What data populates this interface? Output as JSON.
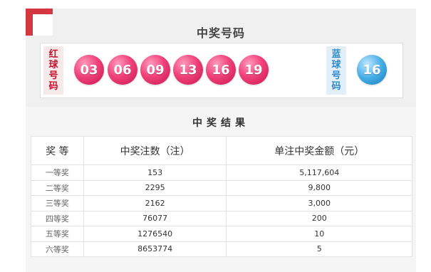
{
  "draw": {
    "title": "中奖号码",
    "red_label_chars": [
      "红",
      "球",
      "号",
      "码"
    ],
    "blue_label_chars": [
      "蓝",
      "球",
      "号",
      "码"
    ],
    "red_balls": [
      "03",
      "06",
      "09",
      "13",
      "16",
      "19"
    ],
    "blue_ball": "16"
  },
  "results": {
    "title": "中奖结果",
    "headers": [
      "奖 等",
      "中奖注数（注）",
      "单注中奖金额（元）"
    ],
    "rows": [
      {
        "level": "一等奖",
        "count": "153",
        "amount": "5,117,604"
      },
      {
        "level": "二等奖",
        "count": "2295",
        "amount": "9,800"
      },
      {
        "level": "三等奖",
        "count": "2162",
        "amount": "3,000"
      },
      {
        "level": "四等奖",
        "count": "76077",
        "amount": "200"
      },
      {
        "level": "五等奖",
        "count": "1276540",
        "amount": "10"
      },
      {
        "level": "六等奖",
        "count": "8653774",
        "amount": "5"
      }
    ]
  },
  "colors": {
    "accent_red": "#d3373f",
    "red_ball": "#f0427a",
    "blue_ball": "#45aee6"
  }
}
